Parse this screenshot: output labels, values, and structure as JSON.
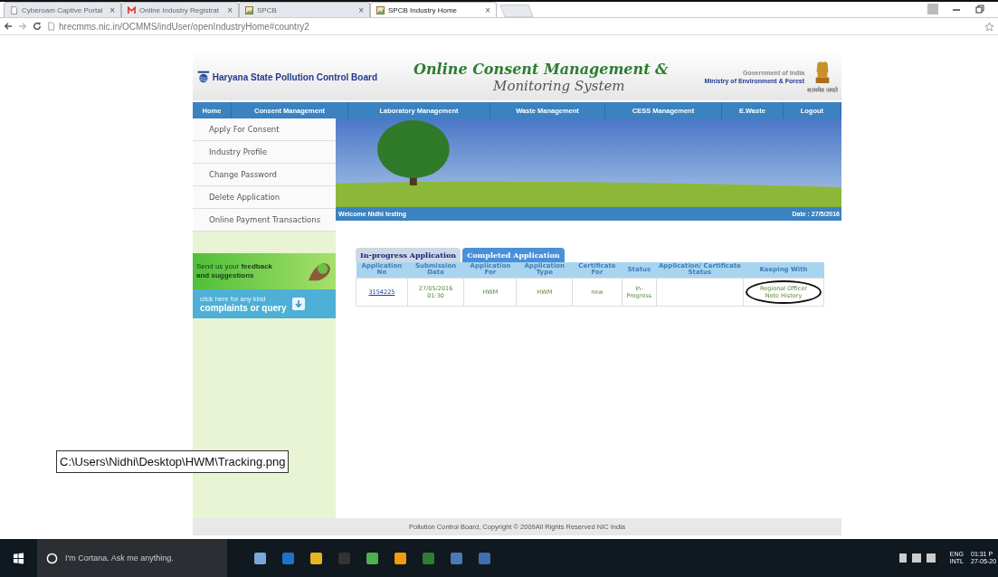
{
  "browser": {
    "tabs": [
      {
        "label": "Cyberoam Captive Portal",
        "kind": "page",
        "selected": false
      },
      {
        "label": "Online Industry Registrat",
        "kind": "mail",
        "selected": false
      },
      {
        "label": "SPCB",
        "kind": "image",
        "selected": false
      },
      {
        "label": "SPCB Industry Home",
        "kind": "image",
        "selected": true
      }
    ],
    "close": "×",
    "url": "hrecmms.nic.in/OCMMS/indUser/openIndustryHome#country2"
  },
  "header": {
    "board": "Haryana State Pollution Control Board",
    "title_1": "Online Consent Management &",
    "title_2": "Monitoring System",
    "gov": "Government of India",
    "ministry": "Ministry of Environment & Forest",
    "motto": "सत्यमेव जयते"
  },
  "nav": [
    "Home",
    "Consent Management",
    "Laboratory Management",
    "Waste Management",
    "CESS Management",
    "E.Waste",
    "Logout"
  ],
  "sidebar": {
    "items": [
      "Apply For Consent",
      "Industry Profile",
      "Change Password",
      "Delete Application",
      "Online Payment Transactions"
    ],
    "feedback": {
      "text_1": "Send us your ",
      "bold": "feedback",
      "text_2": "and suggestions"
    },
    "complaints": {
      "small": "click here for any kind",
      "big": "complaints or query"
    }
  },
  "welcome": "Welcome Nidhi testing",
  "date": "Date : 27/5/2016",
  "app_tabs": [
    {
      "label": "In-progress Application",
      "selected": false
    },
    {
      "label": "Completed Application",
      "selected": true
    }
  ],
  "table": {
    "columns": [
      "Application No",
      "Submission Date",
      "Application For",
      "Application Type",
      "Certificate For",
      "Status",
      "Application/ Certificate Status",
      "Keeping With"
    ],
    "rows": [
      {
        "cells": [
          "3154225",
          "27/05/2016 01:30",
          "HWM",
          "HWM",
          "new",
          "In-Progress",
          "",
          "Regional Officer Note History"
        ],
        "circled": true
      }
    ]
  },
  "footer": "Pollution Control Board, Copyright © 2009All Rights Reserved NIC India",
  "tooltip": "C:\\Users\\Nidhi\\Desktop\\HWM\\Tracking.png",
  "taskbar": {
    "search_placeholder": "I'm Cortana. Ask me anything.",
    "lang_1": "ENG",
    "lang_2": "INTL",
    "time": "01:31 P",
    "date": "27-05-20"
  }
}
